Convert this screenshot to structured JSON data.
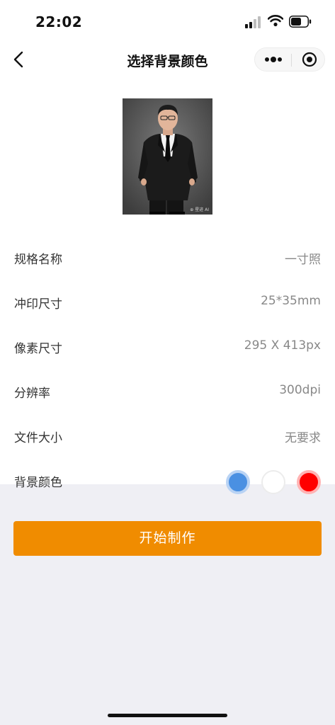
{
  "status_bar": {
    "time": "22:02"
  },
  "nav": {
    "title": "选择背景颜色"
  },
  "photo": {
    "watermark": "⊕ 星迹 AI"
  },
  "specs": [
    {
      "label": "规格名称",
      "value": "一寸照"
    },
    {
      "label": "冲印尺寸",
      "value": "25*35mm"
    },
    {
      "label": "像素尺寸",
      "value": "295 X 413px"
    },
    {
      "label": "分辨率",
      "value": "300dpi"
    },
    {
      "label": "文件大小",
      "value": "无要求"
    }
  ],
  "background": {
    "label": "背景颜色",
    "colors": [
      {
        "name": "blue",
        "hex": "#4a90e2",
        "selected": true
      },
      {
        "name": "white",
        "hex": "#ffffff",
        "selected": false
      },
      {
        "name": "red",
        "hex": "#ff0000",
        "selected": false
      }
    ]
  },
  "action": {
    "start_label": "开始制作"
  },
  "theme": {
    "accent": "#f08c00"
  }
}
